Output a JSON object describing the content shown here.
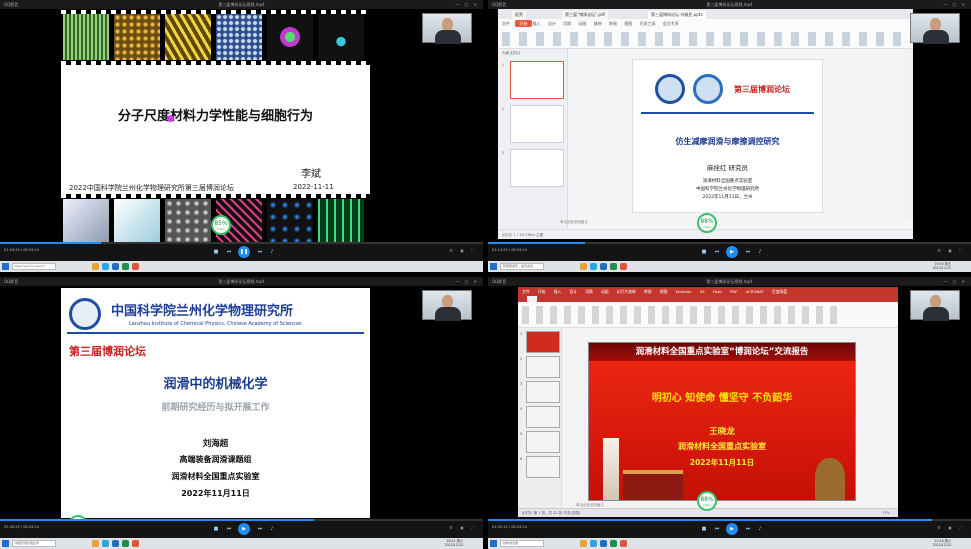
{
  "app_name": "QQ影音",
  "q1": {
    "window_title": "第三届博润论坛视频.mp4",
    "slide_title": "分子尺度材料力学性能与细胞行为",
    "author": "李斌",
    "date": "2022-11-11",
    "footer": "2022中国科学院兰州化学物理研究所第三届博润论坛",
    "badge": {
      "value": "85",
      "unit": "%",
      "sub": "0.4k/s"
    },
    "time": "01:16:29 / 06:03:24",
    "taskbar": {
      "search": "Type here to search",
      "clock_time": "",
      "clock_date": ""
    }
  },
  "q2": {
    "window_title": "第三届博润论坛视频.mp4",
    "file_tabs": [
      "稻壳",
      "第三届“博润论坛”.pdf",
      "第三届博润论坛-刘维民.pptx"
    ],
    "ribbon_start": "开始",
    "ribbon_menu": "文件  开始  插入  设计  切换  动画  放映  审阅  视图  开发工具  会员专享",
    "side_tabs": "大纲  幻灯片",
    "slide_forum": "第三届博润论坛",
    "slide_title": "仿生减摩润滑与摩擦调控研究",
    "slide_person": "麻拴红  研究员",
    "slide_org1": "润滑材料全国重点实验室",
    "slide_org2": "中国科学院兰州化学物理研究所",
    "slide_date": "2022年11月11日，兰州",
    "notes": "单击此处添加备注",
    "status": "幻灯片 1 / 18   Office 主题",
    "badge": {
      "value": "88",
      "unit": "%",
      "sub": "0.6k/s"
    },
    "time": "01:14:25 / 06:03:24",
    "taskbar": {
      "item": "阿里斯塔页 - 稻壳会员",
      "clock_time": "19:03 周五",
      "clock_date": "2022/11/12"
    }
  },
  "q3": {
    "window_title": "第三届博润论坛视频.mp4",
    "inst_cn": "中国科学院兰州化学物理研究所",
    "inst_en": "Lanzhou Institute of Chemical Physics, Chinese Academy of Sciences",
    "forum": "第三届博润论坛",
    "title": "润滑中的机械化学",
    "subtitle": "前期研究经历与拟开展工作",
    "name": "刘海超",
    "group": "高端装备润滑课题组",
    "lab": "润滑材料全国重点实验室",
    "date": "2022年11月11日",
    "badge": {
      "value": "80",
      "unit": "%",
      "sub": "0.1k/s"
    },
    "time": "05:36:29 / 06:03:24",
    "taskbar": {
      "item": "中国高层管理业界",
      "clock_time": "18:41 周六",
      "clock_date": "2022/11/12"
    }
  },
  "q4": {
    "window_title": "第三届博润论坛视频.mp4",
    "ribbon_menu": "文件  开始  插入  设计  切换  动画  幻灯片放映  审阅  视图  Endnote X9  Foxit PDF  ACROBAT  百度网盘",
    "banner": "润滑材料全国重点实验室“博润论坛”交流报告",
    "motto": "明初心 知使命 懂坚守 不负韶华",
    "name": "王晓龙",
    "lab": "润滑材料全国重点实验室",
    "date": "2022年11月11日",
    "notes": "单击此处添加备注",
    "status": "幻灯片 第 1 张，共 22 张   中文(中国)",
    "zoom": "77%",
    "badge": {
      "value": "88",
      "unit": "%",
      "sub": "0.6k/s"
    },
    "time": "04:50:14 / 06:03:24",
    "taskbar": {
      "item": "搜狗浏览器",
      "clock_time": "22:46 周六",
      "clock_date": "2022/11/12"
    }
  },
  "colors": {
    "accent": "#1e8cf0",
    "forum_red": "#c8201d",
    "title_blue": "#1d3f8a",
    "banner_yellow": "#ffe400"
  }
}
